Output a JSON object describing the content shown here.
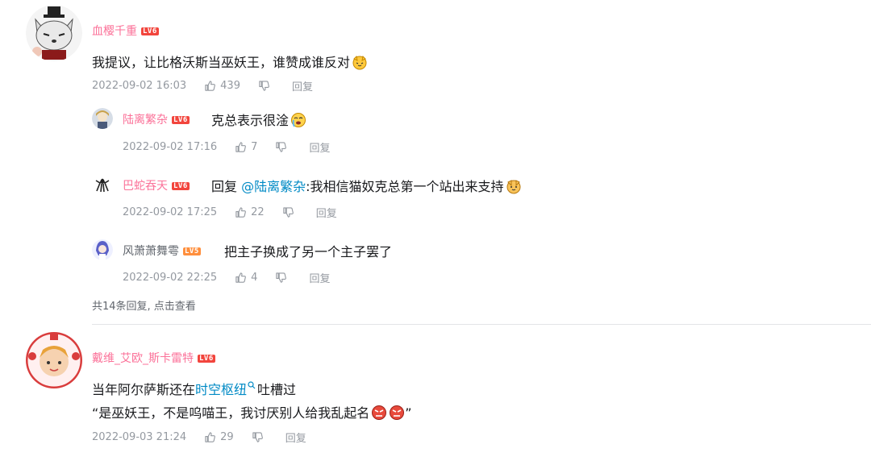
{
  "comments": [
    {
      "user": "血樱千重",
      "level": "LV6",
      "text": "我提议，让比格沃斯当巫妖王，谁赞成谁反对",
      "time": "2022-09-02 16:03",
      "likes": "439",
      "reply_label": "回复",
      "replies": [
        {
          "user": "陆离繁杂",
          "level": "LV6",
          "text": "克总表示很淦",
          "time": "2022-09-02 17:16",
          "likes": "7",
          "reply_label": "回复"
        },
        {
          "user": "巴蛇吞天",
          "level": "LV6",
          "reply_prefix": "回复",
          "mention": "@陆离繁杂",
          "text": ":我相信猫奴克总第一个站出来支持",
          "time": "2022-09-02 17:25",
          "likes": "22",
          "reply_label": "回复"
        },
        {
          "user": "风萧萧舞雩",
          "level": "LV5",
          "text": "把主子换成了另一个主子罢了",
          "time": "2022-09-02 22:25",
          "likes": "4",
          "reply_label": "回复"
        }
      ],
      "more_replies": "共14条回复, 点击查看"
    },
    {
      "user": "戴维_艾欧_斯卡雷特",
      "level": "LV6",
      "text_line1_before": "当年阿尔萨斯还在",
      "text_line1_link": "时空枢纽",
      "text_line1_after": "吐槽过",
      "text_line2": "“是巫妖王，不是呜喵王，我讨厌别人给我乱起名",
      "text_line2_end": "”",
      "time": "2022-09-03 21:24",
      "likes": "29",
      "reply_label": "回复"
    }
  ],
  "colors": {
    "username": "#fb7299",
    "level6": "#f2453d",
    "level5": "#ff8f3d",
    "link": "#008ac5",
    "meta": "#9499a0"
  }
}
